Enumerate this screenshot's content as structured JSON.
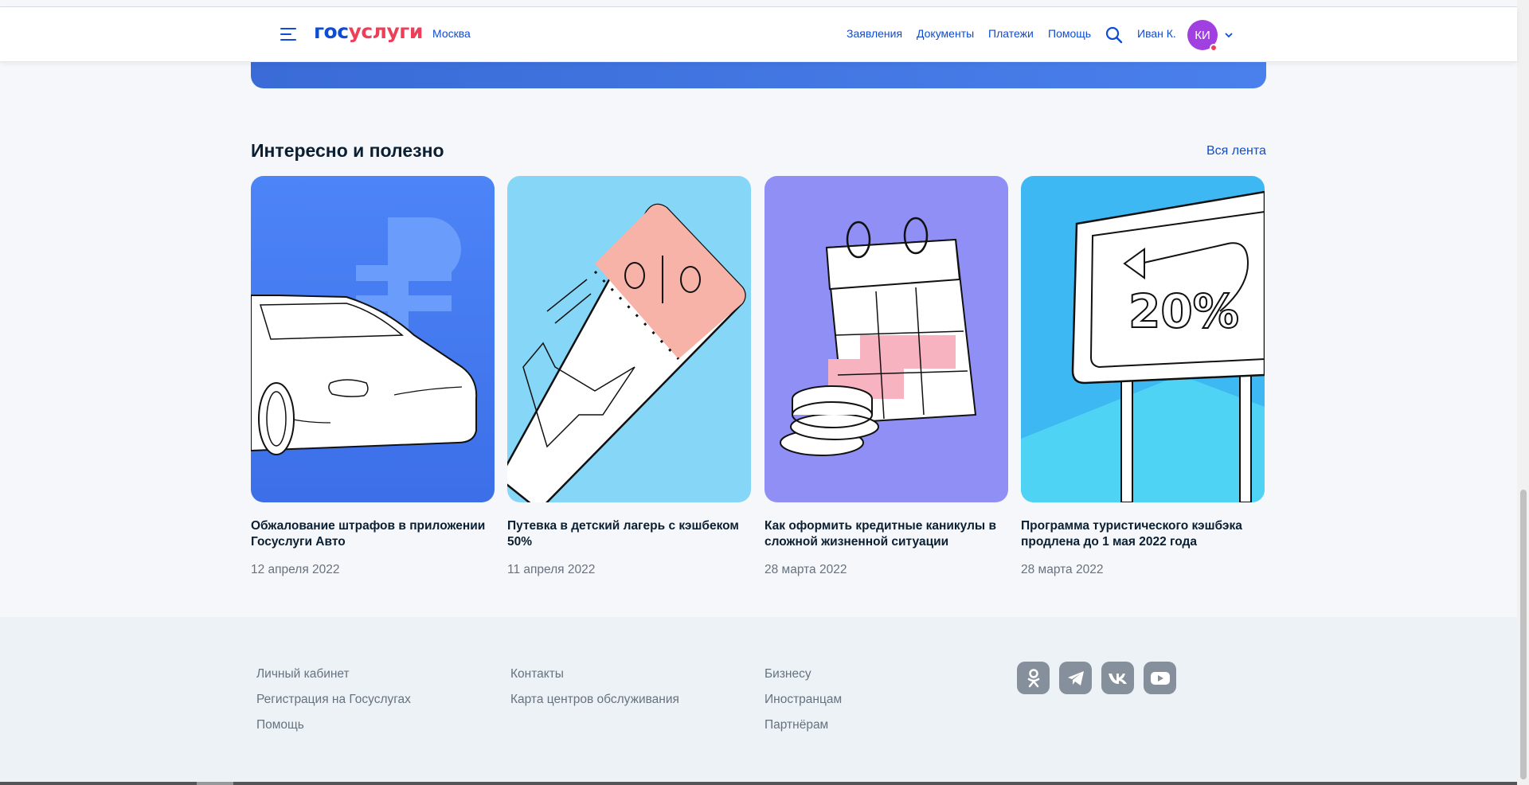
{
  "header": {
    "logo_part1": "гос",
    "logo_part2": "услуги",
    "city": "Москва",
    "nav": [
      "Заявления",
      "Документы",
      "Платежи",
      "Помощь"
    ],
    "user_name": "Иван К.",
    "avatar_initials": "КИ",
    "icons": [
      "menu-icon",
      "search-icon",
      "chevron-down-icon"
    ]
  },
  "section": {
    "title": "Интересно и полезно",
    "all_link": "Вся лента"
  },
  "cards": [
    {
      "title": "Обжалование штрафов в приложении Госуслуги Авто",
      "date": "12 апреля 2022",
      "bg": "#4a82f5"
    },
    {
      "title": "Путевка в детский лагерь с кэшбеком 50%",
      "date": "11 апреля 2022",
      "bg": "#86d6f8"
    },
    {
      "title": "Как оформить кредитные каникулы в сложной жизненной ситуации",
      "date": "28 марта 2022",
      "bg": "#8f8ff5"
    },
    {
      "title": "Программа туристического кэшбэка продлена до 1 мая 2022 года",
      "date": "28 марта 2022",
      "bg": "#3eb8f2"
    }
  ],
  "footer": {
    "col1": [
      "Личный кабинет",
      "Регистрация на Госуслугах",
      "Помощь"
    ],
    "col2": [
      "Контакты",
      "Карта центров обслуживания"
    ],
    "col3": [
      "Бизнесу",
      "Иностранцам",
      "Партнёрам"
    ],
    "social": [
      "odnoklassniki-icon",
      "telegram-icon",
      "vk-icon",
      "youtube-icon"
    ]
  },
  "card_images": {
    "card3_percent": "20%"
  }
}
